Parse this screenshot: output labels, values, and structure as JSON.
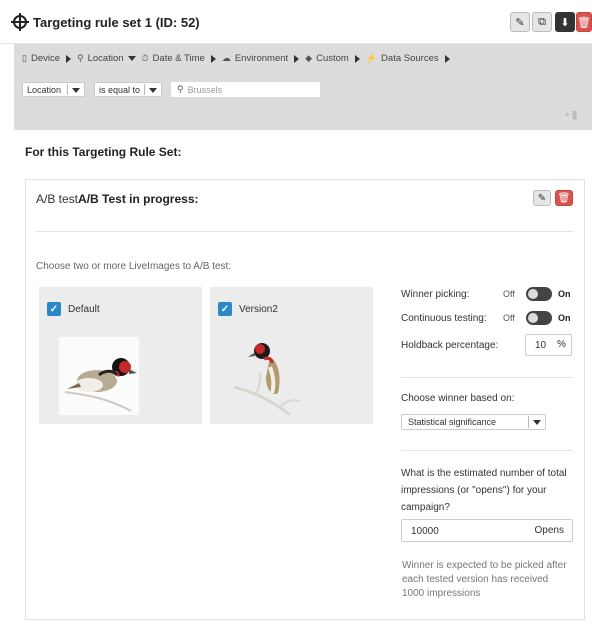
{
  "header": {
    "title": "Targeting rule set 1 (ID: 52)"
  },
  "targeting": {
    "crumbs": [
      {
        "label": "Device",
        "icon": "device-icon"
      },
      {
        "label": "Location",
        "icon": "location-pin-icon"
      },
      {
        "label": "Date & Time",
        "icon": "clock-icon"
      },
      {
        "label": "Environment",
        "icon": "cloud-icon"
      },
      {
        "label": "Custom",
        "icon": "tag-icon"
      },
      {
        "label": "Data Sources",
        "icon": "plug-icon"
      }
    ],
    "field_select": "Location",
    "operator_select": "is equal to",
    "location_placeholder": "Brussels"
  },
  "section_title": "For this Targeting Rule Set:",
  "ab_test": {
    "title_prefix": "A/B test",
    "title_status": "A/B Test in progress:",
    "choose_label": "Choose two or more LiveImages to A/B test:",
    "variants": [
      {
        "label": "Default",
        "checked": true
      },
      {
        "label": "Version2",
        "checked": true
      }
    ],
    "winner_picking": {
      "label": "Winner picking:",
      "off": "Off",
      "on": "On"
    },
    "continuous_testing": {
      "label": "Continuous testing:",
      "off": "Off",
      "on": "On"
    },
    "holdback": {
      "label": "Holdback percentage:",
      "value": "10",
      "unit": "%"
    },
    "choose_winner": {
      "label": "Choose winner based on:",
      "selected": "Statistical significance"
    },
    "impressions_question": "What is the estimated number of total impressions (or \"opens\") for your campaign?",
    "impressions": {
      "value": "10000",
      "unit": "Opens"
    },
    "info_text": "Winner is expected to be picked after each tested version has received 1000 impressions"
  },
  "colors": {
    "accent_blue": "#2a87c8",
    "delete_red": "#d9534f",
    "panel_grey": "#dcdcdc"
  }
}
